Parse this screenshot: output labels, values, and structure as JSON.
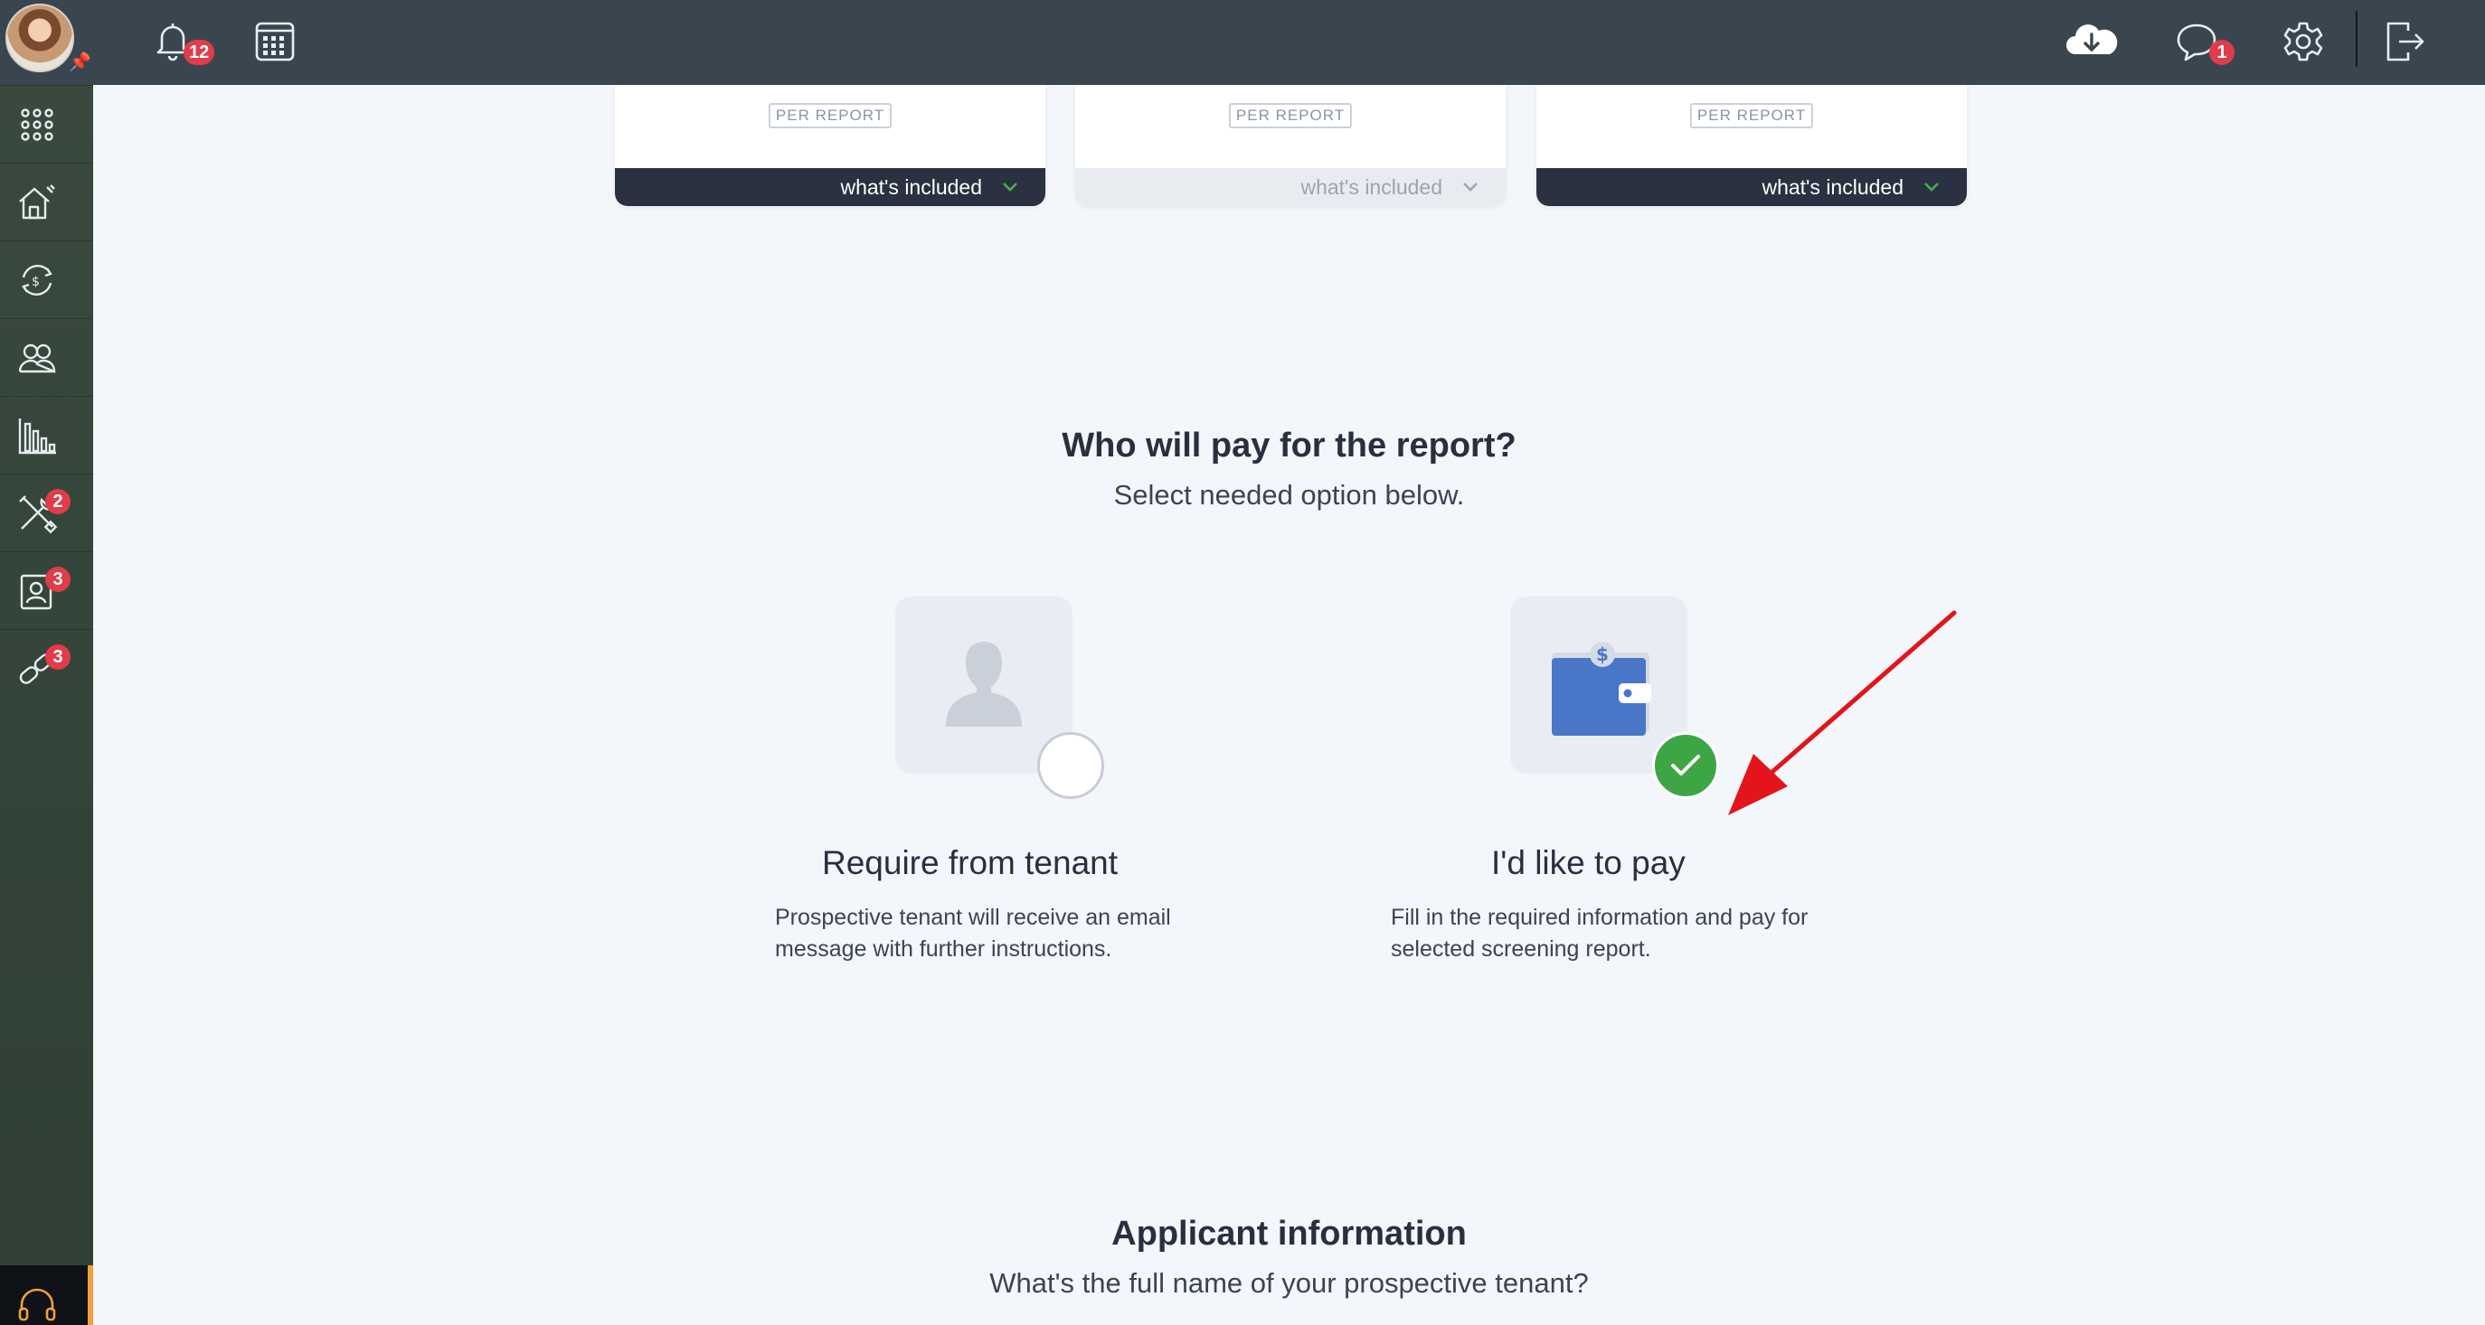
{
  "topbar": {
    "notifications_count": "12",
    "messages_count": "1"
  },
  "sidebar": {
    "badges": {
      "maintenance": "2",
      "tenants": "3",
      "services": "3"
    }
  },
  "plans": [
    {
      "price_unit": "PER REPORT",
      "included_label": "what's included"
    },
    {
      "price_unit": "PER REPORT",
      "included_label": "what's included"
    },
    {
      "price_unit": "PER REPORT",
      "included_label": "what's included"
    }
  ],
  "payer": {
    "title": "Who will pay for the report?",
    "subtitle": "Select needed option below.",
    "options": [
      {
        "title": "Require from tenant",
        "description": "Prospective tenant will receive an email message with further instructions.",
        "selected": false
      },
      {
        "title": "I'd like to pay",
        "description": "Fill in the required information and pay for selected screening report.",
        "selected": true
      }
    ]
  },
  "applicant": {
    "title": "Applicant information",
    "subtitle": "What's the full name of your prospective tenant?"
  },
  "colors": {
    "accent_green": "#3ea544",
    "badge_red": "#e03c4a",
    "wallet_blue": "#4a76c7",
    "dark_navy": "#2a3140"
  }
}
